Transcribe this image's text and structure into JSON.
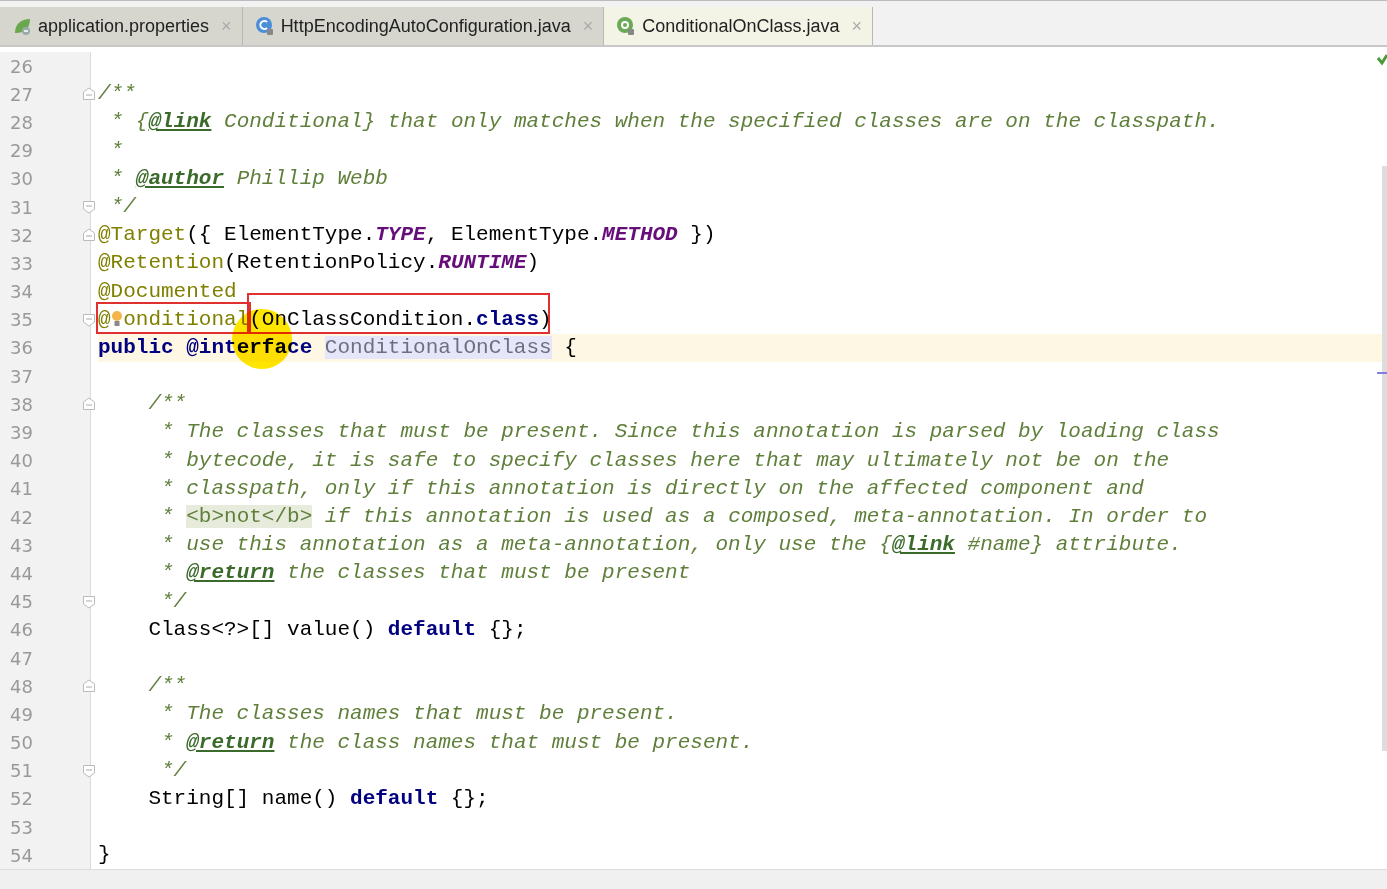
{
  "tabs": [
    {
      "label": "application.properties",
      "kind": "spring",
      "close": "×",
      "selected": false
    },
    {
      "label": "HttpEncodingAutoConfiguration.java",
      "kind": "class",
      "close": "×",
      "selected": false
    },
    {
      "label": "ConditionalOnClass.java",
      "kind": "annotation",
      "close": "×",
      "selected": true
    }
  ],
  "pointer_highlight": true,
  "lines": [
    {
      "number": "26",
      "current": false
    },
    {
      "number": "27",
      "current": false,
      "fold_start": true,
      "tokens": [
        {
          "kind": "comment",
          "text": "/**"
        }
      ]
    },
    {
      "number": "28",
      "current": false,
      "tokens": [
        {
          "kind": "comment",
          "text": " * {"
        },
        {
          "kind": "doctag",
          "text": "@link"
        },
        {
          "kind": "comment",
          "text": " Conditional} that only matches when the specified classes are on the classpath."
        }
      ]
    },
    {
      "number": "29",
      "current": false,
      "tokens": [
        {
          "kind": "comment",
          "text": " *"
        }
      ]
    },
    {
      "number": "30",
      "current": false,
      "tokens": [
        {
          "kind": "comment",
          "text": " * "
        },
        {
          "kind": "doctag",
          "text": "@author"
        },
        {
          "kind": "comment",
          "text": " Phillip Webb"
        }
      ]
    },
    {
      "number": "31",
      "current": false,
      "fold_end": true,
      "tokens": [
        {
          "kind": "comment",
          "text": " */"
        }
      ]
    },
    {
      "number": "32",
      "current": false,
      "fold_start": true,
      "tokens": [
        {
          "kind": "annotation",
          "text": "@Target"
        },
        {
          "kind": "plain",
          "text": "({ ElementType."
        },
        {
          "kind": "constant",
          "text": "TYPE"
        },
        {
          "kind": "plain",
          "text": ", ElementType."
        },
        {
          "kind": "constant",
          "text": "METHOD"
        },
        {
          "kind": "plain",
          "text": " })"
        }
      ]
    },
    {
      "number": "33",
      "current": false,
      "tokens": [
        {
          "kind": "annotation",
          "text": "@Retention"
        },
        {
          "kind": "plain",
          "text": "(RetentionPolicy."
        },
        {
          "kind": "constant",
          "text": "RUNTIME"
        },
        {
          "kind": "plain",
          "text": ")"
        }
      ]
    },
    {
      "number": "34",
      "current": false,
      "tokens": [
        {
          "kind": "annotation",
          "text": "@Documented"
        }
      ]
    },
    {
      "number": "35",
      "current": false,
      "fold_end": true,
      "tokens": [
        {
          "kind": "highlighted",
          "tokens": [
            {
              "kind": "annotation",
              "text": "@"
            },
            {
              "kind": "bulb"
            },
            {
              "kind": "annotation",
              "text": "onditional"
            }
          ]
        },
        {
          "kind": "highlighted",
          "tokens": [
            {
              "kind": "plain",
              "text": "(OnClassCondition."
            },
            {
              "kind": "keyword",
              "text": "class"
            },
            {
              "kind": "plain",
              "text": ")"
            }
          ]
        }
      ]
    },
    {
      "number": "36",
      "current": true,
      "tokens": [
        {
          "kind": "keyword",
          "text": "public "
        },
        {
          "kind": "keyword",
          "text": "@interface "
        },
        {
          "kind": "declaration",
          "text": "ConditionalOnClass"
        },
        {
          "kind": "plain",
          "text": " {"
        }
      ]
    },
    {
      "number": "37",
      "current": false
    },
    {
      "number": "38",
      "current": false,
      "fold_start": true,
      "tokens": [
        {
          "kind": "comment",
          "text": "    /**"
        }
      ]
    },
    {
      "number": "39",
      "current": false,
      "tokens": [
        {
          "kind": "comment",
          "text": "     * The classes that must be present. Since this annotation is parsed by loading class"
        }
      ]
    },
    {
      "number": "40",
      "current": false,
      "tokens": [
        {
          "kind": "comment",
          "text": "     * bytecode, it is safe to specify classes here that may ultimately not be on the"
        }
      ]
    },
    {
      "number": "41",
      "current": false,
      "tokens": [
        {
          "kind": "comment",
          "text": "     * classpath, only if this annotation is directly on the affected component and"
        }
      ]
    },
    {
      "number": "42",
      "current": false,
      "tokens": [
        {
          "kind": "comment",
          "text": "     * "
        },
        {
          "kind": "htmltag",
          "text": "<b>"
        },
        {
          "kind": "htmltext",
          "text": "not"
        },
        {
          "kind": "htmltag",
          "text": "</b>"
        },
        {
          "kind": "comment",
          "text": " if this annotation is used as a composed, meta-annotation. In order to"
        }
      ]
    },
    {
      "number": "43",
      "current": false,
      "tokens": [
        {
          "kind": "comment",
          "text": "     * use this annotation as a meta-annotation, only use the {"
        },
        {
          "kind": "doctag",
          "text": "@link"
        },
        {
          "kind": "comment",
          "text": " #name} attribute."
        }
      ]
    },
    {
      "number": "44",
      "current": false,
      "tokens": [
        {
          "kind": "comment",
          "text": "     * "
        },
        {
          "kind": "doctag",
          "text": "@return"
        },
        {
          "kind": "comment",
          "text": " the classes that must be present"
        }
      ]
    },
    {
      "number": "45",
      "current": false,
      "fold_end": true,
      "tokens": [
        {
          "kind": "comment",
          "text": "     */"
        }
      ]
    },
    {
      "number": "46",
      "current": false,
      "tokens": [
        {
          "kind": "plain",
          "text": "    Class<?>[] value() "
        },
        {
          "kind": "keyword",
          "text": "default"
        },
        {
          "kind": "plain",
          "text": " {};"
        }
      ]
    },
    {
      "number": "47",
      "current": false
    },
    {
      "number": "48",
      "current": false,
      "fold_start": true,
      "tokens": [
        {
          "kind": "comment",
          "text": "    /**"
        }
      ]
    },
    {
      "number": "49",
      "current": false,
      "tokens": [
        {
          "kind": "comment",
          "text": "     * The classes names that must be present."
        }
      ]
    },
    {
      "number": "50",
      "current": false,
      "tokens": [
        {
          "kind": "comment",
          "text": "     * "
        },
        {
          "kind": "doctag",
          "text": "@return"
        },
        {
          "kind": "comment",
          "text": " the class names that must be present."
        }
      ]
    },
    {
      "number": "51",
      "current": false,
      "fold_end": true,
      "tokens": [
        {
          "kind": "comment",
          "text": "     */"
        }
      ]
    },
    {
      "number": "52",
      "current": false,
      "tokens": [
        {
          "kind": "plain",
          "text": "    String[] name() "
        },
        {
          "kind": "keyword",
          "text": "default"
        },
        {
          "kind": "plain",
          "text": " {};"
        }
      ]
    },
    {
      "number": "53",
      "current": false
    },
    {
      "number": "54",
      "current": false,
      "tokens": [
        {
          "kind": "plain",
          "text": "}"
        }
      ]
    }
  ]
}
